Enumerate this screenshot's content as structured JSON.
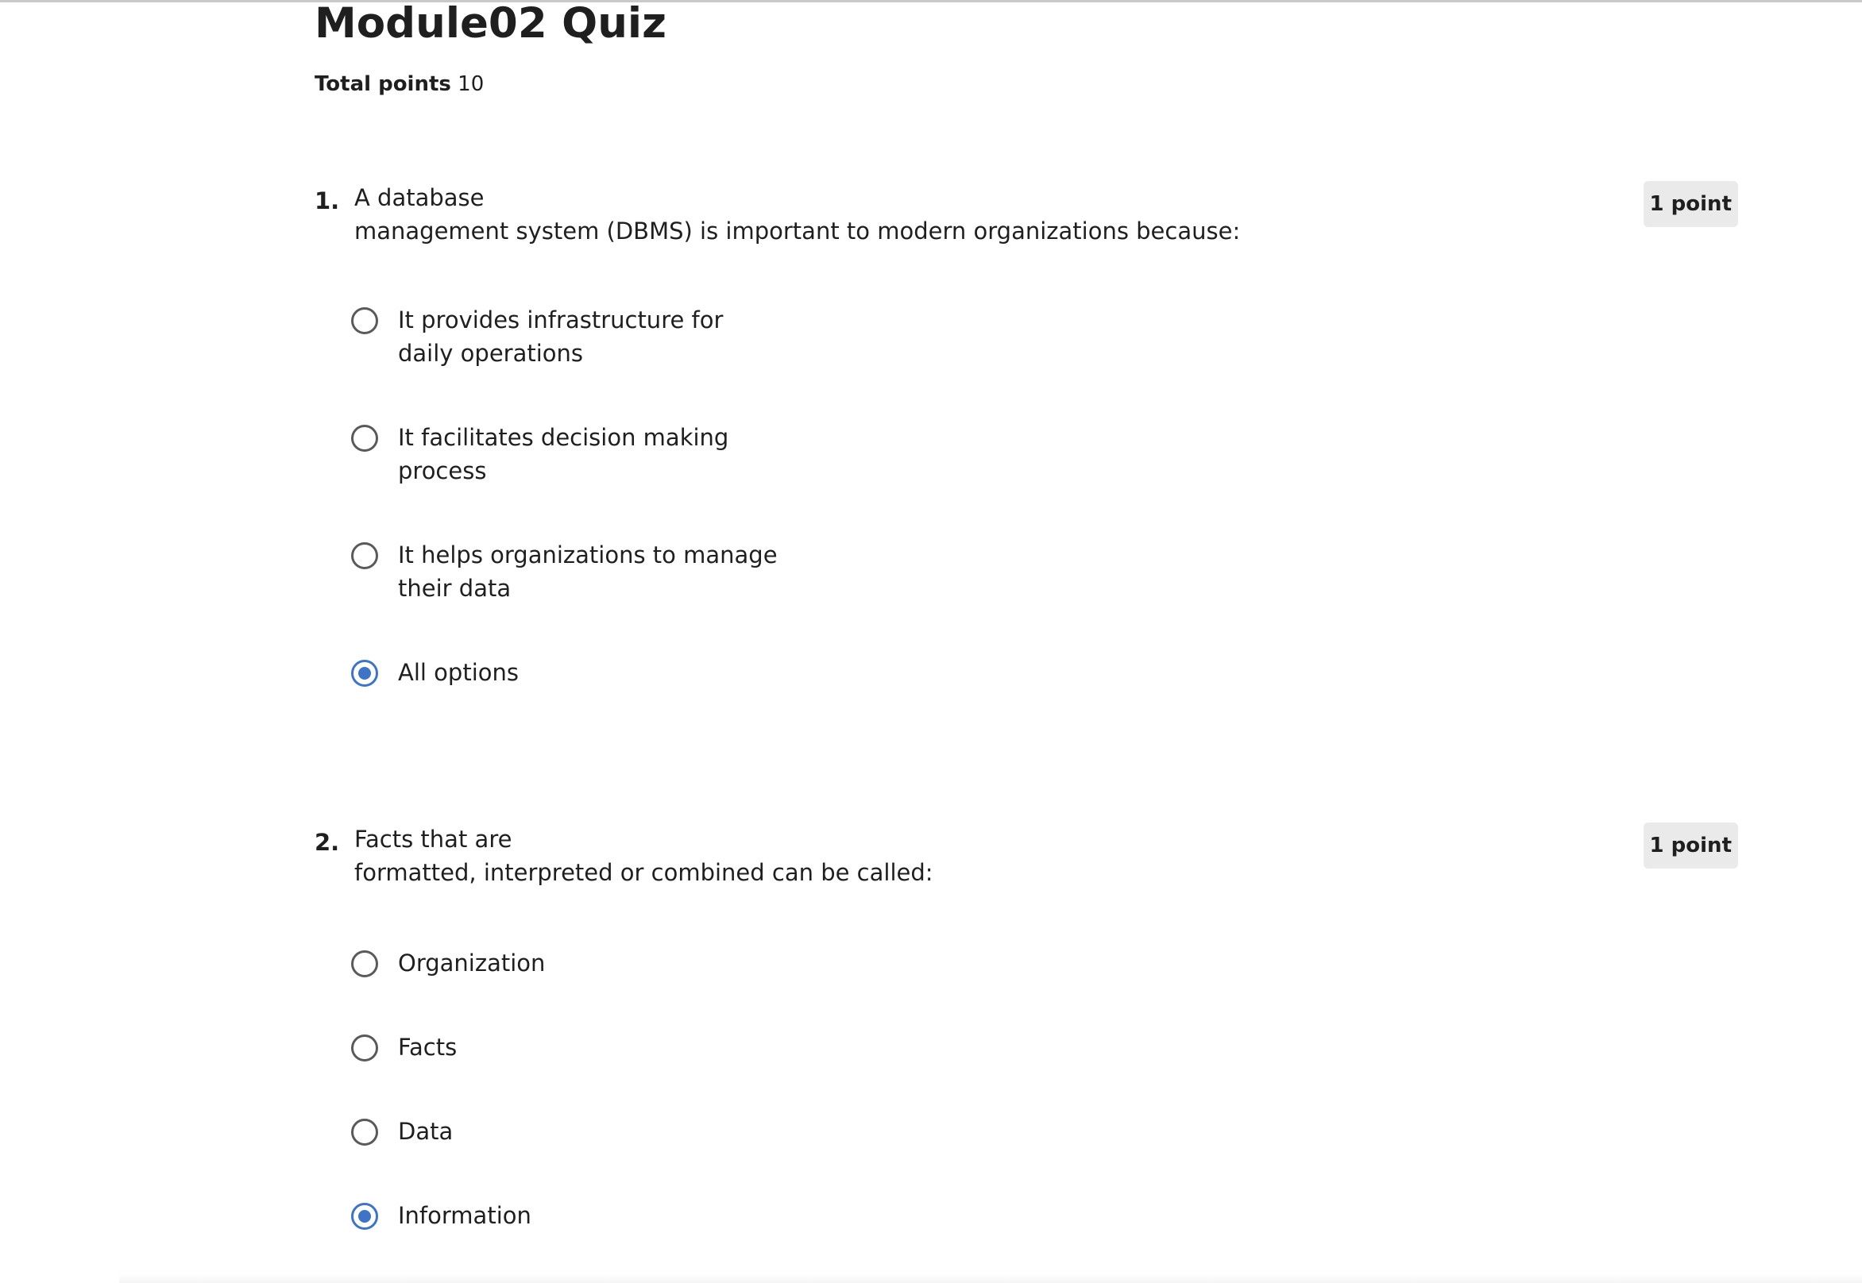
{
  "quiz": {
    "title": "Module02 Quiz",
    "total_points_label": "Total points",
    "total_points_value": "10"
  },
  "questions": [
    {
      "number": "1.",
      "text": "A database\nmanagement system (DBMS) is important to modern organizations because:",
      "points": "1 point",
      "options": [
        {
          "label": "It provides infrastructure for\ndaily operations",
          "selected": false
        },
        {
          "label": "It facilitates decision making\nprocess",
          "selected": false
        },
        {
          "label": "It helps organizations to manage\ntheir data",
          "selected": false
        },
        {
          "label": "All options",
          "selected": true
        }
      ]
    },
    {
      "number": "2.",
      "text": "Facts that are\nformatted, interpreted or combined can be called:",
      "points": "1 point",
      "options": [
        {
          "label": "Organization",
          "selected": false
        },
        {
          "label": "Facts",
          "selected": false
        },
        {
          "label": "Data",
          "selected": false
        },
        {
          "label": "Information",
          "selected": true
        }
      ]
    }
  ],
  "colors": {
    "accent": "#3f73c6",
    "text": "#1f1f1f",
    "badge_bg": "#eaeaea",
    "radio_border": "#5a5a5a"
  }
}
